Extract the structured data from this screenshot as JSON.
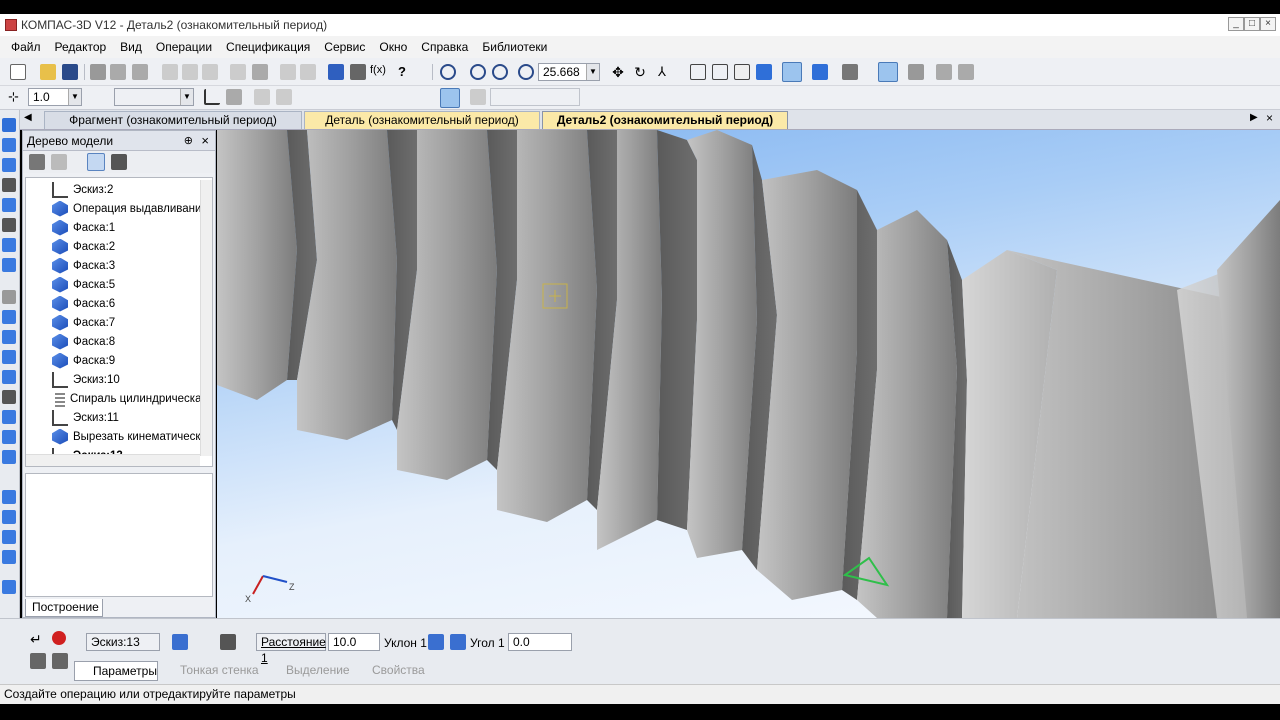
{
  "window": {
    "title": "КОМПАС-3D V12 - Деталь2 (ознакомительный период)"
  },
  "menu": [
    "Файл",
    "Редактор",
    "Вид",
    "Операции",
    "Спецификация",
    "Сервис",
    "Окно",
    "Справка",
    "Библиотеки"
  ],
  "toolbar": {
    "zoom_value": "25.668",
    "step_value": "1.0"
  },
  "tabs": [
    {
      "label": "Фрагмент (ознакомительный период)",
      "state": "inactive"
    },
    {
      "label": "Деталь (ознакомительный период)",
      "state": "inactive-highlight"
    },
    {
      "label": "Деталь2 (ознакомительный период)",
      "state": "active"
    }
  ],
  "tree": {
    "title": "Дерево модели",
    "items": [
      {
        "label": "Эскиз:2",
        "icon": "sketch-icon"
      },
      {
        "label": "Операция выдавливания",
        "icon": "extrude-icon"
      },
      {
        "label": "Фаска:1",
        "icon": "chamfer-icon"
      },
      {
        "label": "Фаска:2",
        "icon": "chamfer-icon"
      },
      {
        "label": "Фаска:3",
        "icon": "chamfer-icon"
      },
      {
        "label": "Фаска:5",
        "icon": "chamfer-icon"
      },
      {
        "label": "Фаска:6",
        "icon": "chamfer-icon"
      },
      {
        "label": "Фаска:7",
        "icon": "chamfer-icon"
      },
      {
        "label": "Фаска:8",
        "icon": "chamfer-icon"
      },
      {
        "label": "Фаска:9",
        "icon": "chamfer-icon"
      },
      {
        "label": "Эскиз:10",
        "icon": "sketch-icon"
      },
      {
        "label": "Спираль цилиндрическая",
        "icon": "spiral-icon"
      },
      {
        "label": "Эскиз:11",
        "icon": "sketch-icon"
      },
      {
        "label": "Вырезать кинематически",
        "icon": "cut-icon"
      },
      {
        "label": "Эскиз:13",
        "icon": "sketch-icon"
      }
    ],
    "tab_label": "Построение"
  },
  "viewport": {
    "axis_x": "X",
    "axis_z": "Z"
  },
  "properties": {
    "sketch_value": "Эскиз:13",
    "distance_label": "Расстояние 1",
    "distance_value": "10.0",
    "slope_label": "Уклон 1",
    "angle_label": "Угол 1",
    "angle_value": "0.0",
    "tabs": [
      {
        "label": "Параметры",
        "state": "active"
      },
      {
        "label": "Тонкая стенка",
        "state": "disabled"
      },
      {
        "label": "Выделение",
        "state": "disabled"
      },
      {
        "label": "Свойства",
        "state": "disabled"
      }
    ]
  },
  "status": "Создайте операцию или отредактируйте параметры",
  "colors": {
    "accent": "#1a4cb8",
    "tab_highlight": "#fbe9a8",
    "sky_top": "#7fb2f0",
    "thread": "#9c9c9c"
  }
}
